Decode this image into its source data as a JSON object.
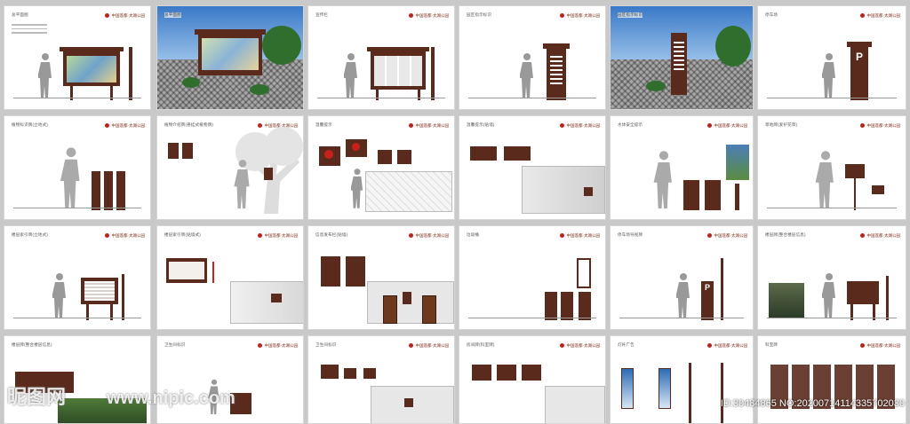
{
  "header": {
    "project": "中国莲都·太湖公园",
    "subtitle": "园区导视系统设计方案"
  },
  "sheets": [
    {
      "title": "总平面图"
    },
    {
      "title": "总平面图"
    },
    {
      "title": "宣传栏"
    },
    {
      "title": "园区指示标识"
    },
    {
      "title": "园区指示标识"
    },
    {
      "title": "停车场"
    },
    {
      "title": "植物标识牌(立地式)"
    },
    {
      "title": "植物介绍牌(悬挂式植物牌)"
    },
    {
      "title": "温馨提示"
    },
    {
      "title": "温馨提示(贴墙)"
    },
    {
      "title": "水体安全提示"
    },
    {
      "title": "草地牌(爱护花草)"
    },
    {
      "title": "楼层索引牌(立地式)"
    },
    {
      "title": "楼层索引牌(贴墙式)"
    },
    {
      "title": "信息发布栏(贴墙)"
    },
    {
      "title": "垃圾桶"
    },
    {
      "title": "停车场导视牌"
    },
    {
      "title": "楼层牌(整合楼层信息)"
    },
    {
      "title": "楼层牌(整合楼层信息)"
    },
    {
      "title": "卫生间标识"
    },
    {
      "title": "卫生间标识"
    },
    {
      "title": "房间牌(科室牌)"
    },
    {
      "title": "灯杆广告"
    },
    {
      "title": "科室牌"
    }
  ],
  "signs": {
    "parking_letter": "P"
  },
  "watermark": {
    "site": "昵图网",
    "url": "www.nipic.com",
    "id": "ID:30484865 NO:20200714114335702030"
  }
}
